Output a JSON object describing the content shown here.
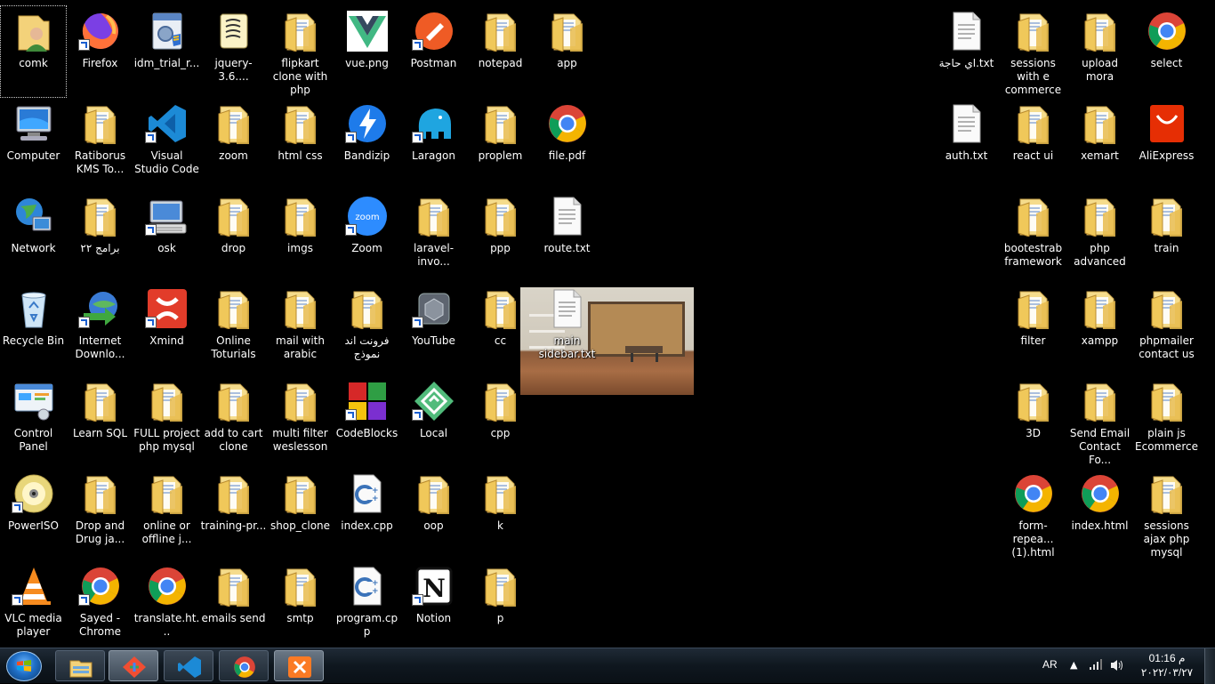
{
  "desktop": {
    "icons": [
      {
        "label": "comk",
        "type": "user-folder",
        "selected": true
      },
      {
        "label": "Firefox",
        "type": "firefox",
        "shortcut": true
      },
      {
        "label": "idm_trial_r...",
        "type": "installer"
      },
      {
        "label": "jquery-3.6....",
        "type": "script"
      },
      {
        "label": "flipkart clone with php",
        "type": "folder"
      },
      {
        "label": "vue.png",
        "type": "vue"
      },
      {
        "label": "Postman",
        "type": "postman",
        "shortcut": true
      },
      {
        "label": "notepad",
        "type": "folder"
      },
      {
        "label": "app",
        "type": "folder"
      },
      {
        "label": "Computer",
        "type": "computer"
      },
      {
        "label": "Ratiborus KMS To...",
        "type": "folder"
      },
      {
        "label": "Visual Studio Code",
        "type": "vscode",
        "shortcut": true
      },
      {
        "label": "zoom",
        "type": "folder"
      },
      {
        "label": "html css",
        "type": "folder"
      },
      {
        "label": "Bandizip",
        "type": "bandizip",
        "shortcut": true
      },
      {
        "label": "Laragon",
        "type": "laragon",
        "shortcut": true
      },
      {
        "label": "proplem",
        "type": "folder"
      },
      {
        "label": "file.pdf",
        "type": "chrome"
      },
      {
        "label": "Network",
        "type": "network"
      },
      {
        "label": "برامج ٢٢",
        "type": "folder"
      },
      {
        "label": "osk",
        "type": "keyboard",
        "shortcut": true
      },
      {
        "label": "drop",
        "type": "folder"
      },
      {
        "label": "imgs",
        "type": "folder"
      },
      {
        "label": "Zoom",
        "type": "zoom",
        "shortcut": true
      },
      {
        "label": "laravel-invo...",
        "type": "folder"
      },
      {
        "label": "ppp",
        "type": "folder"
      },
      {
        "label": "route.txt",
        "type": "text"
      },
      {
        "label": "Recycle Bin",
        "type": "recycle"
      },
      {
        "label": "Internet Downlo...",
        "type": "idm",
        "shortcut": true
      },
      {
        "label": "Xmind",
        "type": "xmind",
        "shortcut": true
      },
      {
        "label": "Online Toturials",
        "type": "folder"
      },
      {
        "label": "mail with arabic",
        "type": "folder"
      },
      {
        "label": "فرونت اند نموذج",
        "type": "folder"
      },
      {
        "label": "YouTube",
        "type": "youtube",
        "shortcut": true
      },
      {
        "label": "cc",
        "type": "folder"
      },
      {
        "label": "main sidebar.txt",
        "type": "text"
      },
      {
        "label": "Control Panel",
        "type": "control"
      },
      {
        "label": "Learn SQL",
        "type": "folder"
      },
      {
        "label": "FULL project php mysql",
        "type": "folder"
      },
      {
        "label": "add to cart clone",
        "type": "folder"
      },
      {
        "label": "multi filter weslesson",
        "type": "folder"
      },
      {
        "label": "CodeBlocks",
        "type": "codeblocks",
        "shortcut": true
      },
      {
        "label": "Local",
        "type": "local",
        "shortcut": true
      },
      {
        "label": "cpp",
        "type": "folder"
      },
      {
        "label": "PowerISO",
        "type": "poweriso",
        "shortcut": true
      },
      {
        "label": "Drop and Drug ja...",
        "type": "folder"
      },
      {
        "label": "online or offline j...",
        "type": "folder"
      },
      {
        "label": "training-pr...",
        "type": "folder"
      },
      {
        "label": "shop_clone",
        "type": "folder"
      },
      {
        "label": "index.cpp",
        "type": "cpp"
      },
      {
        "label": "oop",
        "type": "folder"
      },
      {
        "label": "k",
        "type": "folder"
      },
      {
        "label": "VLC media player",
        "type": "vlc",
        "shortcut": true
      },
      {
        "label": "Sayed - Chrome",
        "type": "chrome",
        "shortcut": true
      },
      {
        "label": "translate.ht...",
        "type": "chrome"
      },
      {
        "label": "emails send",
        "type": "folder"
      },
      {
        "label": "smtp",
        "type": "folder"
      },
      {
        "label": "program.cpp",
        "type": "cpp"
      },
      {
        "label": "Notion",
        "type": "notion",
        "shortcut": true
      },
      {
        "label": "p",
        "type": "folder"
      },
      {
        "label": "اي حاجة.txt",
        "type": "text"
      },
      {
        "label": "sessions with e commerce",
        "type": "folder"
      },
      {
        "label": "upload mora",
        "type": "folder"
      },
      {
        "label": "select",
        "type": "chrome"
      },
      {
        "label": "auth.txt",
        "type": "text"
      },
      {
        "label": "react ui",
        "type": "folder"
      },
      {
        "label": "xemart",
        "type": "folder"
      },
      {
        "label": "AliExpress",
        "type": "aliexpress"
      },
      {
        "label": "bootestrab framework",
        "type": "folder"
      },
      {
        "label": "php advanced",
        "type": "folder"
      },
      {
        "label": "train",
        "type": "folder"
      },
      {
        "label": "filter",
        "type": "folder"
      },
      {
        "label": "xampp",
        "type": "folder"
      },
      {
        "label": "phpmailer contact us",
        "type": "folder"
      },
      {
        "label": "3D",
        "type": "folder"
      },
      {
        "label": "Send Email Contact Fo...",
        "type": "folder"
      },
      {
        "label": "plain js Ecommerce",
        "type": "folder"
      },
      {
        "label": "form-repea... (1).html",
        "type": "chrome"
      },
      {
        "label": "index.html",
        "type": "chrome"
      },
      {
        "label": "sessions ajax php mysql",
        "type": "folder"
      }
    ]
  },
  "taskbar": {
    "items": [
      {
        "name": "explorer",
        "type": "explorer"
      },
      {
        "name": "git-app",
        "type": "git"
      },
      {
        "name": "vscode",
        "type": "vscode"
      },
      {
        "name": "chrome",
        "type": "chrome"
      },
      {
        "name": "xampp",
        "type": "xampp"
      }
    ],
    "language": "AR",
    "time": "01:16 م",
    "date": "٢٠٢٢/٠٣/٢٧"
  },
  "colors": {
    "taskbar": "#0f171f",
    "folder": "#f3d27a",
    "label": "#ffffff"
  }
}
